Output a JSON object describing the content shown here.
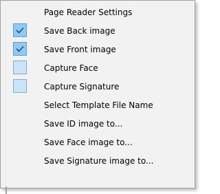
{
  "menu": {
    "items": [
      {
        "label": "Page Reader Settings",
        "checkbox": "none"
      },
      {
        "label": "Save Back image",
        "checkbox": "checked"
      },
      {
        "label": "Save Front image",
        "checkbox": "checked"
      },
      {
        "label": "Capture Face",
        "checkbox": "unchecked"
      },
      {
        "label": "Capture Signature",
        "checkbox": "unchecked"
      },
      {
        "label": "Select Template File Name",
        "checkbox": "none"
      },
      {
        "label": "Save ID image to...",
        "checkbox": "none"
      },
      {
        "label": "Save Face image to...",
        "checkbox": "none"
      },
      {
        "label": "Save Signature image to...",
        "checkbox": "none"
      }
    ],
    "colors": {
      "background": "#f2f2f2",
      "check_box_fill": "#cce4f7",
      "checked_box_fill": "#90c8f6",
      "checkmark": "#1f4e79"
    }
  }
}
